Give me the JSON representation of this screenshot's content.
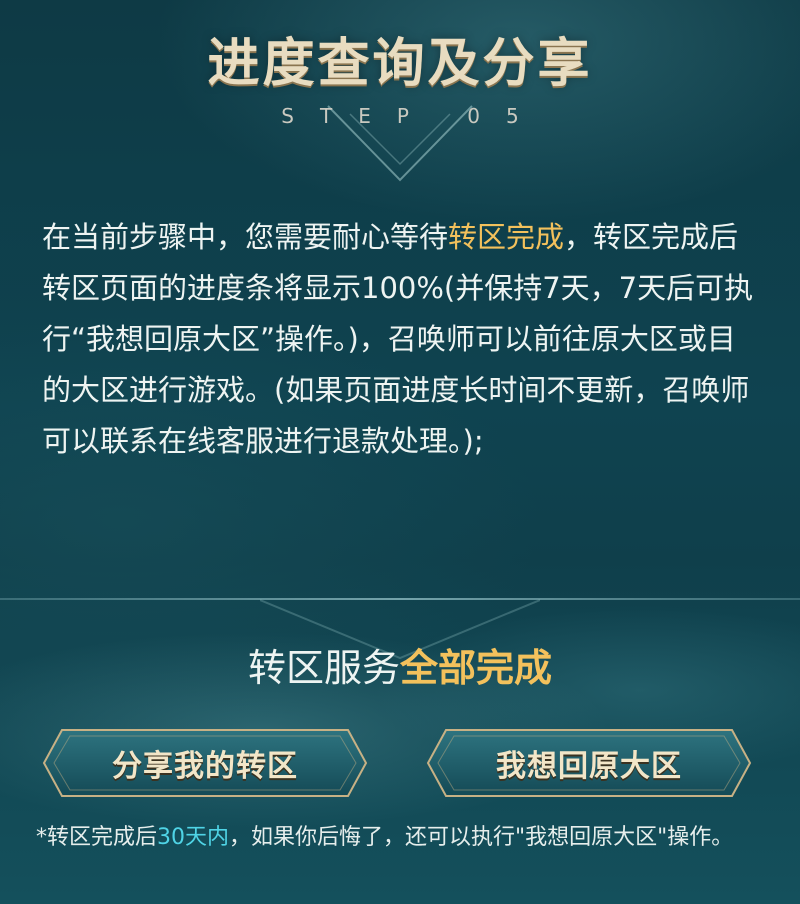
{
  "heading": {
    "title": "进度查询及分享",
    "step": "STEP 05"
  },
  "instruction": {
    "before": "在当前步骤中，您需要耐心等待",
    "highlight": "转区完成",
    "after": "，转区完成后转区页面的进度条将显示100%(并保持7天，7天后可执行“我想回原大区”操作。)，召唤师可以前往原大区或目的大区进行游戏。(如果页面进度长时间不更新，召唤师可以联系在线客服进行退款处理。);"
  },
  "status": {
    "prefix": "转区服务",
    "highlight": "全部完成"
  },
  "buttons": {
    "share": "分享我的转区",
    "return": "我想回原大区"
  },
  "note": {
    "before": "*转区完成后",
    "highlight": "30天内",
    "after": "，如果你后悔了，还可以执行\"我想回原大区\"操作。"
  },
  "colors": {
    "background": "#0f3c48",
    "gold": "#f3c15c",
    "cyan": "#4fd4e6"
  }
}
